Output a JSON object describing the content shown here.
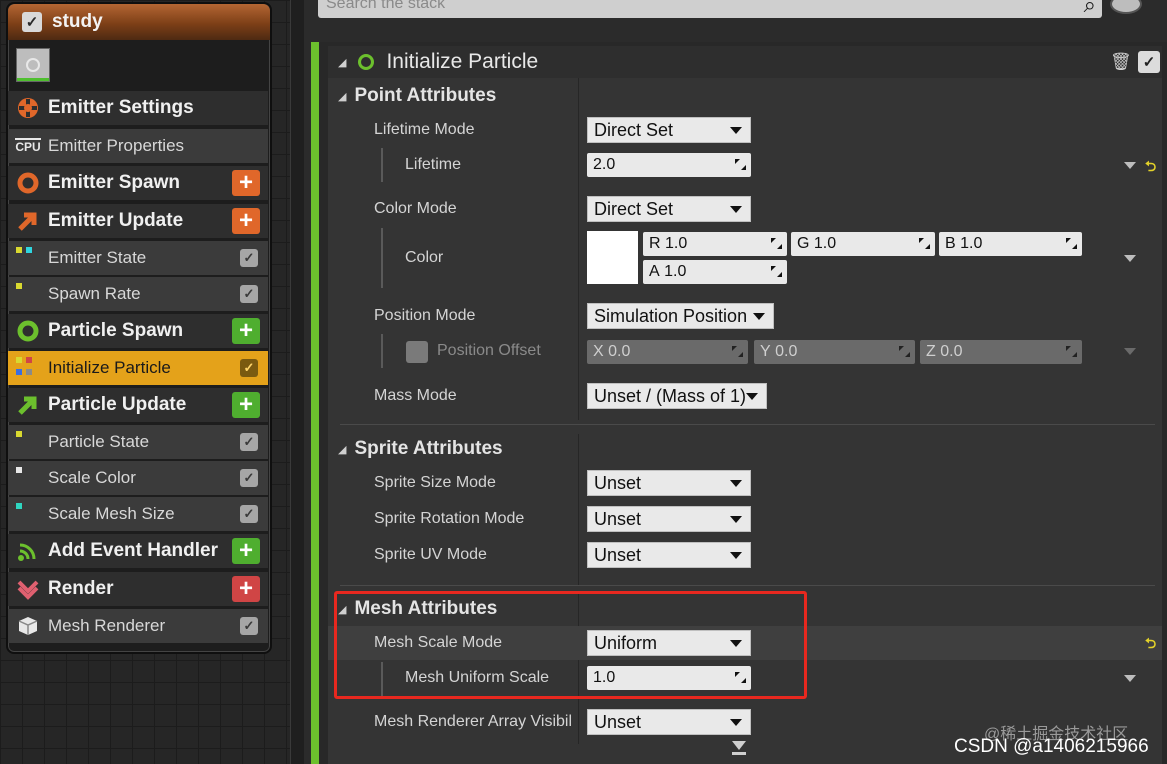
{
  "emitter": {
    "name": "study",
    "stack": [
      {
        "label": "Emitter Settings",
        "kind": "group"
      },
      {
        "label": "Emitter Properties",
        "kind": "item"
      },
      {
        "label": "Emitter Spawn",
        "kind": "group"
      },
      {
        "label": "Emitter Update",
        "kind": "group"
      },
      {
        "label": "Emitter State",
        "kind": "item"
      },
      {
        "label": "Spawn Rate",
        "kind": "item"
      },
      {
        "label": "Particle Spawn",
        "kind": "group"
      },
      {
        "label": "Initialize Particle",
        "kind": "item",
        "selected": true
      },
      {
        "label": "Particle Update",
        "kind": "group"
      },
      {
        "label": "Particle State",
        "kind": "item"
      },
      {
        "label": "Scale Color",
        "kind": "item"
      },
      {
        "label": "Scale Mesh Size",
        "kind": "item"
      },
      {
        "label": "Add Event Handler",
        "kind": "group"
      },
      {
        "label": "Render",
        "kind": "group"
      },
      {
        "label": "Mesh Renderer",
        "kind": "item"
      }
    ],
    "cpu_badge": "CPU"
  },
  "search": {
    "placeholder": "Search the stack"
  },
  "module": {
    "title": "Initialize Particle"
  },
  "sections": {
    "point": "Point Attributes",
    "sprite": "Sprite Attributes",
    "mesh": "Mesh Attributes"
  },
  "props": {
    "lifetime_mode": {
      "label": "Lifetime Mode",
      "value": "Direct Set"
    },
    "lifetime": {
      "label": "Lifetime",
      "value": "2.0"
    },
    "color_mode": {
      "label": "Color Mode",
      "value": "Direct Set"
    },
    "color": {
      "label": "Color",
      "r": "R",
      "r_val": "1.0",
      "g": "G",
      "g_val": "1.0",
      "b": "B",
      "b_val": "1.0",
      "a": "A",
      "a_val": "1.0",
      "swatch": "#ffffff"
    },
    "position_mode": {
      "label": "Position Mode",
      "value": "Simulation Position"
    },
    "position_offset": {
      "label": "Position Offset",
      "x": "X",
      "x_val": "0.0",
      "y": "Y",
      "y_val": "0.0",
      "z": "Z",
      "z_val": "0.0"
    },
    "mass_mode": {
      "label": "Mass Mode",
      "value": "Unset / (Mass of 1)"
    },
    "sprite_size_mode": {
      "label": "Sprite Size Mode",
      "value": "Unset"
    },
    "sprite_rotation_mode": {
      "label": "Sprite Rotation Mode",
      "value": "Unset"
    },
    "sprite_uv_mode": {
      "label": "Sprite UV Mode",
      "value": "Unset"
    },
    "mesh_scale_mode": {
      "label": "Mesh Scale Mode",
      "value": "Uniform"
    },
    "mesh_uniform_scale": {
      "label": "Mesh Uniform Scale",
      "value": "1.0"
    },
    "mesh_renderer_array": {
      "label": "Mesh Renderer Array Visibil",
      "value": "Unset"
    }
  },
  "watermark": {
    "line1": "@稀土掘金技术社区",
    "line2": "CSDN @a1406215966"
  },
  "colors": {
    "accent_green": "#6cc02d",
    "selected": "#e4a21a",
    "highlight_box": "#e8281f",
    "header": "#b46633"
  }
}
